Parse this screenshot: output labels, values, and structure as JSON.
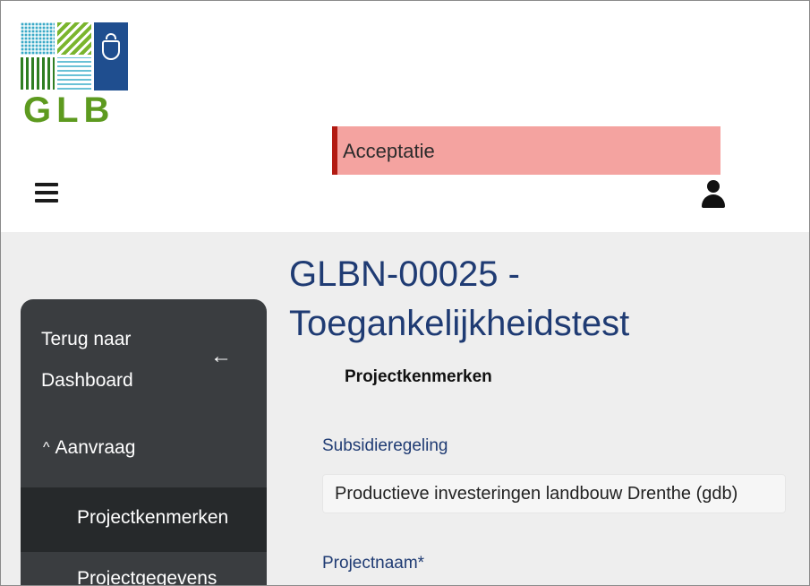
{
  "header": {
    "logo": {
      "text": "GLB",
      "icon": "glb-logo-icon"
    },
    "environment_label": "Acceptatie",
    "colors": {
      "banner_bg": "#f4a3a0",
      "banner_accent": "#b21a12",
      "logo_green": "#5d9a1f",
      "logo_blue": "#1f4e8f"
    },
    "menu_icon": "hamburger-menu-icon",
    "user_icon": "user-icon"
  },
  "sidebar": {
    "back_link_line1": "Terug naar",
    "back_link_line2": "Dashboard",
    "back_icon": "arrow-left-icon",
    "section_caret": "^",
    "section_label": "Aanvraag",
    "items": [
      {
        "label": "Projectkenmerken",
        "active": true
      },
      {
        "label": "Projectgegevens",
        "active": false
      }
    ],
    "colors": {
      "bg": "#3a3d40",
      "active_bg": "#26292b"
    }
  },
  "main": {
    "title": "GLBN-00025 - Toegankelijkheidstest",
    "section_heading": "Projectkenmerken",
    "fields": [
      {
        "label": "Subsidieregeling",
        "value": "Productieve investeringen landbouw Drenthe (gdb)"
      },
      {
        "label": "Projectnaam*"
      }
    ],
    "colors": {
      "title": "#1f3b73",
      "bg": "#eeeeee"
    }
  }
}
